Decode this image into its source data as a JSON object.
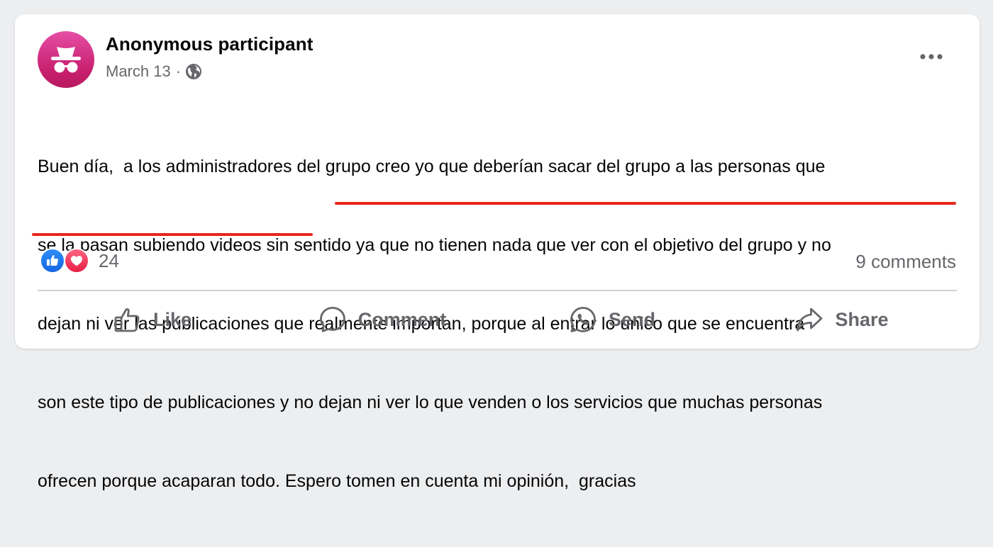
{
  "post": {
    "author": "Anonymous participant",
    "date": "March 13",
    "separator": "·",
    "privacy_icon": "globe-icon",
    "more_icon": "more-horizontal-icon",
    "avatar_icon": "anonymous-incognito-icon",
    "text_lines": [
      "Buen día,  a los administradores del grupo creo yo que deberían sacar del grupo a las personas que",
      "se la pasan subiendo videos sin sentido ya que no tienen nada que ver con el objetivo del grupo y no",
      "dejan ni ver las publicaciones que realmente importan, porque al entrar lo único que se encuentra",
      "son este tipo de publicaciones y no dejan ni ver lo que venden o los servicios que muchas personas",
      "ofrecen porque acaparan todo. Espero tomen en cuenta mi opinión,  gracias"
    ]
  },
  "reactions": {
    "icons": [
      "like-reaction-icon",
      "love-reaction-icon"
    ],
    "count": "24"
  },
  "comments": {
    "count_label": "9 comments"
  },
  "actions": {
    "like": "Like",
    "comment": "Comment",
    "send": "Send",
    "share": "Share"
  },
  "colors": {
    "avatar_gradient_top": "#e64ea5",
    "avatar_gradient_bottom": "#b7195f",
    "underline_annotation": "#e8261b",
    "like_blue": "#1877f2",
    "love_red": "#f33e58",
    "secondary_text": "#65676b",
    "primary_text": "#050505"
  }
}
